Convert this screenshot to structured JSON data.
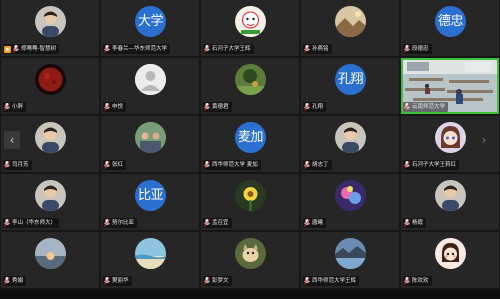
{
  "participants": [
    {
      "name": "郑骞骞-智慧树",
      "avatar_type": "image",
      "avatar_icon": "profile-photo-icon",
      "host": true
    },
    {
      "name": "李春兰—华东师范大学",
      "avatar_type": "text",
      "avatar_text": "大学"
    },
    {
      "name": "石河子大学王辉",
      "avatar_type": "image",
      "avatar_icon": "cartoon-avatar-icon"
    },
    {
      "name": "孙燕铭",
      "avatar_type": "image",
      "avatar_icon": "landscape-photo-icon"
    },
    {
      "name": "段德忠",
      "avatar_type": "text",
      "avatar_text": "德忠"
    },
    {
      "name": "小胖",
      "avatar_type": "image",
      "avatar_icon": "red-moon-icon"
    },
    {
      "name": "申悦",
      "avatar_type": "placeholder",
      "avatar_icon": "default-user-icon"
    },
    {
      "name": "黄德君",
      "avatar_type": "image",
      "avatar_icon": "nature-photo-icon"
    },
    {
      "name": "孔翔",
      "avatar_type": "text",
      "avatar_text": "孔翔"
    },
    {
      "name": "云南师范大学",
      "avatar_type": "video",
      "active": true
    },
    {
      "name": "司月芳",
      "avatar_type": "image",
      "avatar_icon": "profile-photo-icon"
    },
    {
      "name": "张红",
      "avatar_type": "image",
      "avatar_icon": "group-photo-icon"
    },
    {
      "name": "西华师范大学 麦加",
      "avatar_type": "text",
      "avatar_text": "麦加"
    },
    {
      "name": "胡志丁",
      "avatar_type": "image",
      "avatar_icon": "profile-photo-icon"
    },
    {
      "name": "石河子大学王莉红",
      "avatar_type": "image",
      "avatar_icon": "anime-avatar-icon"
    },
    {
      "name": "李山（华东师大）",
      "avatar_type": "image",
      "avatar_icon": "profile-photo-icon"
    },
    {
      "name": "努尔比亚",
      "avatar_type": "text",
      "avatar_text": "比亚"
    },
    {
      "name": "孟召宜",
      "avatar_type": "image",
      "avatar_icon": "flower-photo-icon"
    },
    {
      "name": "唐曦",
      "avatar_type": "image",
      "avatar_icon": "purple-art-icon"
    },
    {
      "name": "杨霞",
      "avatar_type": "image",
      "avatar_icon": "profile-photo-icon"
    },
    {
      "name": "秀娟",
      "avatar_type": "image",
      "avatar_icon": "sunset-photo-icon"
    },
    {
      "name": "樊丽华",
      "avatar_type": "image",
      "avatar_icon": "beach-photo-icon"
    },
    {
      "name": "彭梦文",
      "avatar_type": "image",
      "avatar_icon": "pet-photo-icon"
    },
    {
      "name": "西华师范大学王辉",
      "avatar_type": "image",
      "avatar_icon": "lake-photo-icon"
    },
    {
      "name": "陈欢欢",
      "avatar_type": "image",
      "avatar_icon": "cartoon-girl-icon"
    }
  ],
  "nav": {
    "prev": "‹",
    "next": "›"
  },
  "colors": {
    "text_avatar": "#2b6fd1",
    "active_border": "#3cc13c",
    "host_badge": "#f0a020"
  }
}
